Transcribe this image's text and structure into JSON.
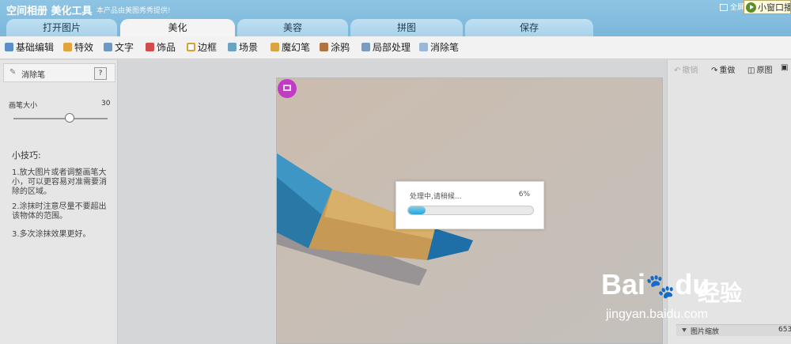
{
  "header": {
    "title": "空间相册 美化工具",
    "subtitle": "本产品由美图秀秀提供!",
    "fullscreen_label": "全屏",
    "mini_window_label": "小窗口播"
  },
  "tabs": [
    {
      "label": "打开图片",
      "active": false
    },
    {
      "label": "美化",
      "active": true
    },
    {
      "label": "美容",
      "active": false
    },
    {
      "label": "拼图",
      "active": false
    },
    {
      "label": "保存",
      "active": false
    }
  ],
  "toolbar": [
    {
      "label": "基础编辑",
      "icon": "edit-icon"
    },
    {
      "label": "特效",
      "icon": "magic-wand-icon"
    },
    {
      "label": "文字",
      "icon": "text-icon"
    },
    {
      "label": "饰品",
      "icon": "bow-icon"
    },
    {
      "label": "边框",
      "icon": "frame-icon"
    },
    {
      "label": "场景",
      "icon": "scene-icon"
    },
    {
      "label": "魔幻笔",
      "icon": "magic-pen-icon"
    },
    {
      "label": "涂鸦",
      "icon": "brush-icon"
    },
    {
      "label": "局部处理",
      "icon": "local-adjust-icon"
    },
    {
      "label": "消除笔",
      "icon": "eraser-pen-icon"
    }
  ],
  "left_panel": {
    "title": "消除笔",
    "help_label": "?",
    "brush_size_label": "画笔大小",
    "brush_size_value": "30",
    "brush_size_fraction": 0.6,
    "tips_title": "小技巧:",
    "tips": [
      "1.放大图片或者调整画笔大小，可以更容易对准需要消除的区域。",
      "2.涂抹时注意尽量不要超出该物体的范围。",
      "3.多次涂抹效果更好。"
    ]
  },
  "dialog": {
    "message": "处理中,请稍候...",
    "percent_label": "6%",
    "progress_fraction": 0.14
  },
  "right_panel": {
    "undo_label": "撤销",
    "redo_label": "重做",
    "original_label": "原图",
    "zoom_label": "图片缩放",
    "zoom_value": "653"
  },
  "watermark": {
    "brand": "Bai",
    "brand2": "du",
    "cn": "经验",
    "url": "jingyan.baidu.com"
  },
  "colors": {
    "header_blue": "#7bb7db",
    "tab_active": "#f4f4f4",
    "progress_fill": "#2aa3d8",
    "crop_button": "#c23bc6"
  }
}
